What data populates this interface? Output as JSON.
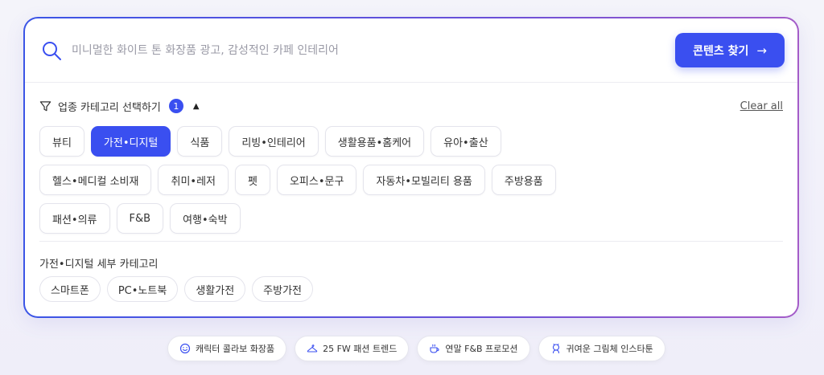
{
  "search": {
    "placeholder": "미니멀한 화이트 톤 화장품 광고, 감성적인 카페 인테리어",
    "button_label": "콘텐츠 찾기",
    "button_arrow": "→"
  },
  "filter": {
    "title": "업종 카테고리 선택하기",
    "count": "1",
    "caret": "▲",
    "clear_label": "Clear all"
  },
  "categories": {
    "row1": [
      "뷰티",
      "가전•디지털",
      "식품",
      "리빙•인테리어",
      "생활용품•홈케어",
      "유아•출산"
    ],
    "row2": [
      "헬스•메디컬 소비재",
      "취미•레저",
      "펫",
      "오피스•문구",
      "자동차•모빌리티 용품",
      "주방용품"
    ],
    "row3": [
      "패션•의류",
      "F&B",
      "여행•숙박"
    ],
    "selected": "가전•디지털"
  },
  "subcategory": {
    "title": "가전•디지털 세부 카테고리",
    "items": [
      "스마트폰",
      "PC•노트북",
      "생활가전",
      "주방가전"
    ]
  },
  "suggestions": [
    {
      "label": "캐릭터 콜라보 화장품",
      "icon": "smile-icon"
    },
    {
      "label": "25 FW 패션 트렌드",
      "icon": "hanger-icon"
    },
    {
      "label": "연말 F&B 프로모션",
      "icon": "coffee-icon"
    },
    {
      "label": "귀여운 그림체 인스타툰",
      "icon": "character-icon"
    }
  ],
  "colors": {
    "accent": "#3a4ff0",
    "border_gradient_start": "#3b55e6",
    "border_gradient_end": "#a45cc8"
  }
}
